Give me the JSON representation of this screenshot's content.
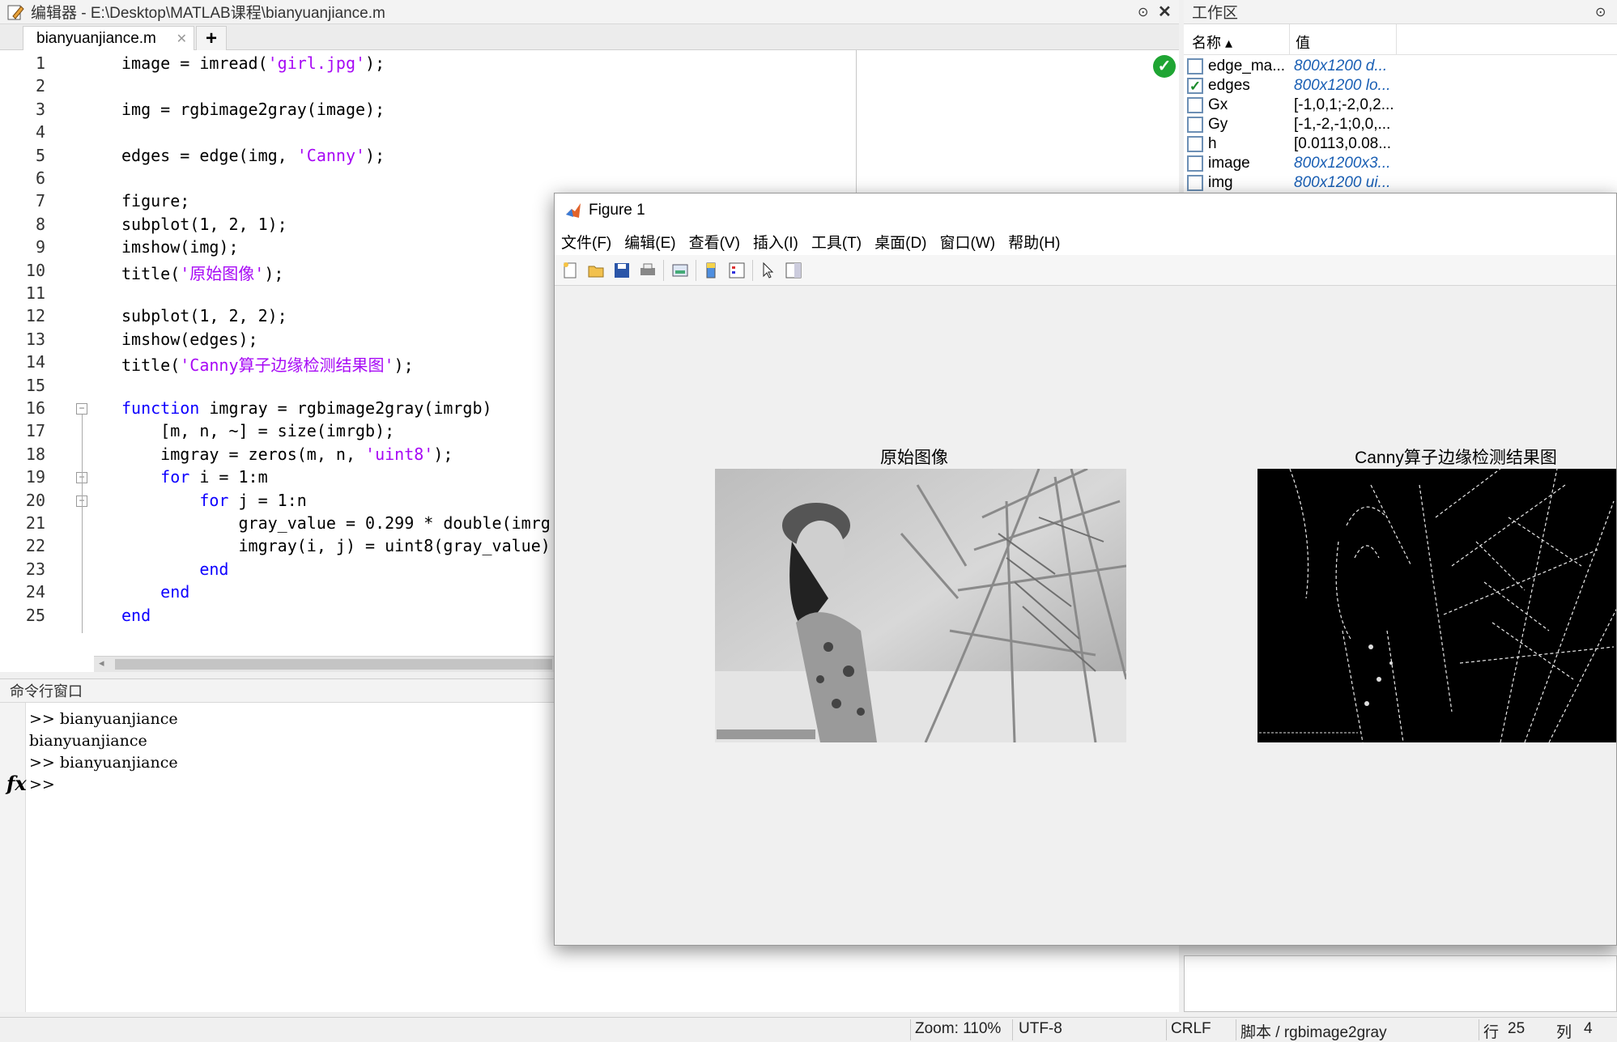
{
  "editor": {
    "title": "编辑器 - E:\\Desktop\\MATLAB课程\\bianyuanjiance.m",
    "tab_label": "bianyuanjiance.m",
    "tab_close": "✕",
    "tab_add": "+",
    "lines": [
      {
        "n": "1",
        "code": [
          {
            "t": "image = imread("
          },
          {
            "t": "'girl.jpg'",
            "c": "st"
          },
          {
            "t": ");"
          }
        ]
      },
      {
        "n": "2",
        "code": []
      },
      {
        "n": "3",
        "code": [
          {
            "t": "img = rgbimage2gray(image);"
          }
        ]
      },
      {
        "n": "4",
        "code": []
      },
      {
        "n": "5",
        "code": [
          {
            "t": "edges = edge(img, "
          },
          {
            "t": "'Canny'",
            "c": "st"
          },
          {
            "t": ");"
          }
        ]
      },
      {
        "n": "6",
        "code": []
      },
      {
        "n": "7",
        "code": [
          {
            "t": "figure;"
          }
        ]
      },
      {
        "n": "8",
        "code": [
          {
            "t": "subplot(1, 2, 1);"
          }
        ]
      },
      {
        "n": "9",
        "code": [
          {
            "t": "imshow(img);"
          }
        ]
      },
      {
        "n": "10",
        "code": [
          {
            "t": "title("
          },
          {
            "t": "'原始图像'",
            "c": "st"
          },
          {
            "t": ");"
          }
        ]
      },
      {
        "n": "11",
        "code": []
      },
      {
        "n": "12",
        "code": [
          {
            "t": "subplot(1, 2, 2);"
          }
        ]
      },
      {
        "n": "13",
        "code": [
          {
            "t": "imshow(edges);"
          }
        ]
      },
      {
        "n": "14",
        "code": [
          {
            "t": "title("
          },
          {
            "t": "'Canny算子边缘检测结果图'",
            "c": "st"
          },
          {
            "t": ");"
          }
        ]
      },
      {
        "n": "15",
        "code": []
      },
      {
        "n": "16",
        "code": [
          {
            "t": "function",
            "c": "kw"
          },
          {
            "t": " imgray = rgbimage2gray(imrgb)"
          }
        ]
      },
      {
        "n": "17",
        "code": [
          {
            "t": "    [m, n, ~] = size(imrgb);"
          }
        ]
      },
      {
        "n": "18",
        "code": [
          {
            "t": "    imgray = zeros(m, n, "
          },
          {
            "t": "'uint8'",
            "c": "st"
          },
          {
            "t": ");"
          }
        ]
      },
      {
        "n": "19",
        "code": [
          {
            "t": "    "
          },
          {
            "t": "for",
            "c": "kw"
          },
          {
            "t": " i = 1:m"
          }
        ]
      },
      {
        "n": "20",
        "code": [
          {
            "t": "        "
          },
          {
            "t": "for",
            "c": "kw"
          },
          {
            "t": " j = 1:n"
          }
        ]
      },
      {
        "n": "21",
        "code": [
          {
            "t": "            gray_value = 0.299 * double(imrg"
          }
        ]
      },
      {
        "n": "22",
        "code": [
          {
            "t": "            imgray(i, j) = uint8(gray_value)"
          }
        ]
      },
      {
        "n": "23",
        "code": [
          {
            "t": "        "
          },
          {
            "t": "end",
            "c": "kw"
          }
        ]
      },
      {
        "n": "24",
        "code": [
          {
            "t": "    "
          },
          {
            "t": "end",
            "c": "kw"
          }
        ]
      },
      {
        "n": "25",
        "code": [
          {
            "t": "end",
            "c": "kw"
          }
        ]
      }
    ]
  },
  "command_window": {
    "title": "命令行窗口",
    "fx": "fx",
    "lines": [
      ">> bianyuanjiance",
      "bianyuanjiance",
      ">> bianyuanjiance",
      ">>"
    ]
  },
  "workspace": {
    "title": "工作区",
    "col_name": "名称 ▴",
    "col_value": "值",
    "rows": [
      {
        "name": "edge_ma...",
        "value": "800x1200 d...",
        "italic": true,
        "icon": "grid"
      },
      {
        "name": "edges",
        "value": "800x1200 lo...",
        "italic": true,
        "icon": "check"
      },
      {
        "name": "Gx",
        "value": "[-1,0,1;-2,0,2...",
        "italic": false,
        "icon": "grid"
      },
      {
        "name": "Gy",
        "value": "[-1,-2,-1;0,0,...",
        "italic": false,
        "icon": "grid"
      },
      {
        "name": "h",
        "value": "[0.0113,0.08...",
        "italic": false,
        "icon": "grid"
      },
      {
        "name": "image",
        "value": "800x1200x3...",
        "italic": true,
        "icon": "grid"
      },
      {
        "name": "img",
        "value": "800x1200 ui...",
        "italic": true,
        "icon": "grid"
      }
    ]
  },
  "figure": {
    "title": "Figure 1",
    "menu": [
      "文件(F)",
      "编辑(E)",
      "查看(V)",
      "插入(I)",
      "工具(T)",
      "桌面(D)",
      "窗口(W)",
      "帮助(H)"
    ],
    "axes1_title": "原始图像",
    "axes2_title": "Canny算子边缘检测结果图"
  },
  "status": {
    "zoom": "Zoom: 110%",
    "encoding": "UTF-8",
    "eol": "CRLF",
    "context": "脚本 / rgbimage2gray",
    "row_label": "行",
    "row": "25",
    "col_label": "列",
    "col": "4"
  },
  "colors": {
    "keyword": "#0e00ff",
    "string": "#a709f5",
    "ok": "#1fa533"
  }
}
